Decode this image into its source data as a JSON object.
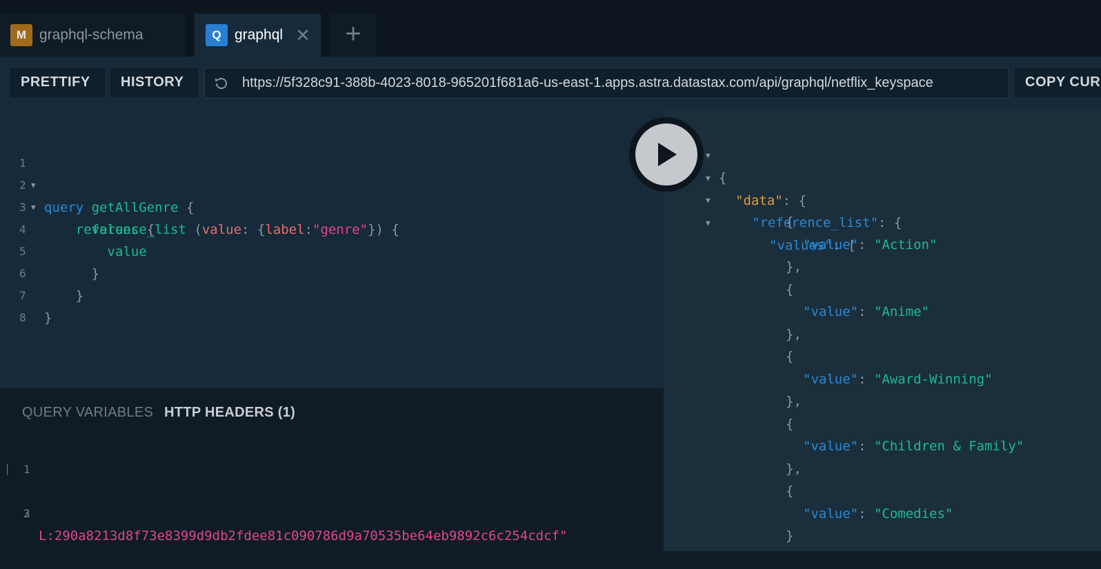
{
  "tabs": [
    {
      "badge": "M",
      "title": "graphql-schema"
    },
    {
      "badge": "Q",
      "title": "graphql",
      "close": "✕"
    }
  ],
  "add_tab": "+",
  "toolbar": {
    "prettify": "PRETTIFY",
    "history": "HISTORY",
    "url": "https://5f328c91-388b-4023-8018-965201f681a6-us-east-1.apps.astra.datastax.com/api/graphql/netflix_keyspace",
    "copy_curl": "COPY CURL"
  },
  "query": {
    "line_numbers": [
      "1",
      "2",
      "3",
      "4",
      "5",
      "6",
      "7",
      "8"
    ],
    "l1": {
      "kw": "query",
      "name": "getAllGenre",
      "brace": " {"
    },
    "l2": {
      "field": "reference_list",
      "open": " (",
      "arg": "value",
      "colon": ": {",
      "arg2": "label",
      "colon2": ":",
      "str": "\"genre\"",
      "close": "}) {"
    },
    "l3": {
      "field": "values",
      "brace": " {"
    },
    "l4": {
      "field": "value"
    },
    "l5": "}",
    "l6": "}",
    "l7": "}"
  },
  "variables": {
    "tab_query_vars": "QUERY VARIABLES",
    "tab_http_headers": "HTTP HEADERS (1)",
    "line_numbers": [
      "1",
      "2",
      "3"
    ],
    "line2": "L:290a8213d8f73e8399d9db2fdee81c090786d9a70535be64eb9892c6c254cdcf\""
  },
  "result": {
    "open_brace": "{",
    "data_key": "\"data\"",
    "ref_key": "\"reference_list\"",
    "values_key": "\"values\"",
    "value_key": "\"value\"",
    "items": [
      "\"Action\"",
      "\"Anime\"",
      "\"Award-Winning\"",
      "\"Children & Family\"",
      "\"Comedies\""
    ]
  }
}
